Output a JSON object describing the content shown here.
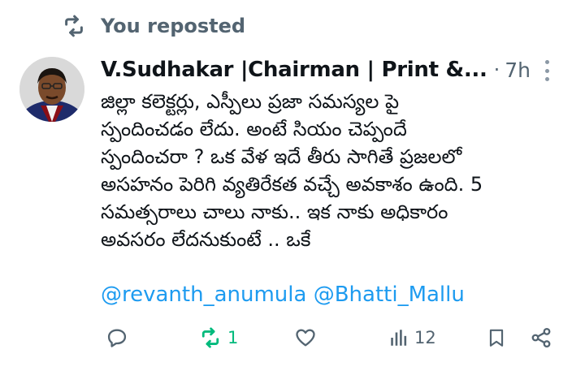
{
  "repost": {
    "label": "You reposted",
    "icon": "repost-icon"
  },
  "tweet": {
    "author_name": "V.Sudhakar |Chairman | Print &...",
    "separator": "·",
    "time": "7h",
    "body_lines": [
      "జిల్లా కలెక్టర్లు, ఎస్పీలు ప్రజా సమస్యల పై",
      "స్పందించడం లేదు. అంటే సియం చెప్పందే",
      "స్పందించరా ? ఒక వేళ ఇదే తీరు సాగితే ప్రజలలో",
      "అసహనం పెరిగి వ్యతిరేకత వచ్చే అవకాశం ఉంది. 5",
      "సమత్సరాలు చాలు నాకు.. ఇక నాకు  అధికారం",
      "అవసరం లేదనుకుంటే .. ఒకే"
    ],
    "mentions": [
      "@revanth_anumula",
      "@Bhatti_Mallu"
    ]
  },
  "actions": {
    "reply_count": "",
    "repost_count": "1",
    "like_count": "",
    "views_count": "12"
  },
  "colors": {
    "text": "#0f1419",
    "secondary": "#536471",
    "link": "#1d9bf0",
    "repost_active": "#00ba7c"
  }
}
